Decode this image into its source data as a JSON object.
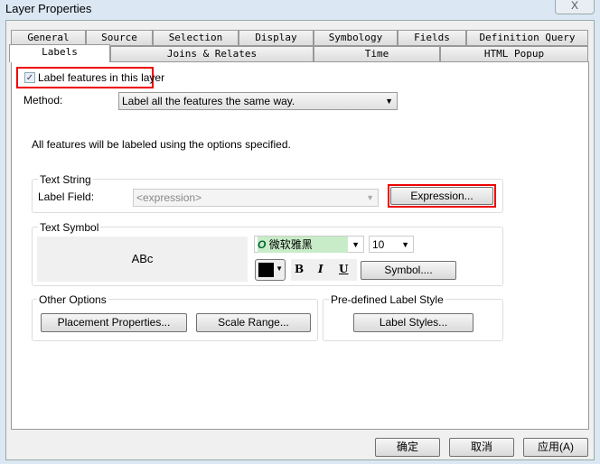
{
  "window": {
    "title": "Layer Properties",
    "close": "X"
  },
  "tabs_row1": [
    "General",
    "Source",
    "Selection",
    "Display",
    "Symbology",
    "Fields",
    "Definition Query"
  ],
  "tabs_row2": [
    "Labels",
    "Joins & Relates",
    "Time",
    "HTML Popup"
  ],
  "label_checkbox": {
    "label": "Label features in this layer",
    "checked": true
  },
  "method": {
    "label": "Method:",
    "value": "Label all the features the same way."
  },
  "info": "All features will be labeled using the options specified.",
  "text_string": {
    "title": "Text String",
    "field_label": "Label Field:",
    "field_value": "<expression>",
    "expression_button": "Expression..."
  },
  "text_symbol": {
    "title": "Text Symbol",
    "preview": "ABc",
    "font": "微软雅黑",
    "size": "10",
    "bold": "B",
    "italic": "I",
    "underline": "U",
    "symbol_button": "Symbol....",
    "color": "#000000"
  },
  "other_options": {
    "title": "Other Options",
    "placement": "Placement Properties...",
    "scale": "Scale Range..."
  },
  "predefined": {
    "title": "Pre-defined Label Style",
    "button": "Label Styles..."
  },
  "footer": {
    "ok": "确定",
    "cancel": "取消",
    "apply": "应用(A)"
  }
}
